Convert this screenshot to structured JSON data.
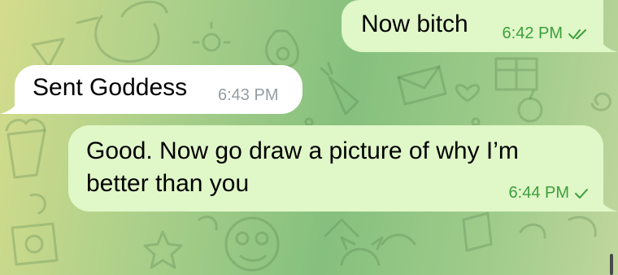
{
  "messages": [
    {
      "text": "Now bitch",
      "time": "6:42 PM",
      "direction": "outgoing",
      "status": "read"
    },
    {
      "text": "Sent Goddess",
      "time": "6:43 PM",
      "direction": "incoming"
    },
    {
      "text": "Good. Now go draw a picture of why I’m\nbetter than you",
      "time": "6:44 PM",
      "direction": "outgoing",
      "status": "sent"
    }
  ],
  "colors": {
    "outgoing_bubble": "#e0f7c8",
    "incoming_bubble": "#ffffff",
    "outgoing_meta": "#3c9f3c",
    "incoming_meta": "#959da3"
  },
  "icons": {
    "read": "double-check-icon",
    "sent": "single-check-icon"
  }
}
